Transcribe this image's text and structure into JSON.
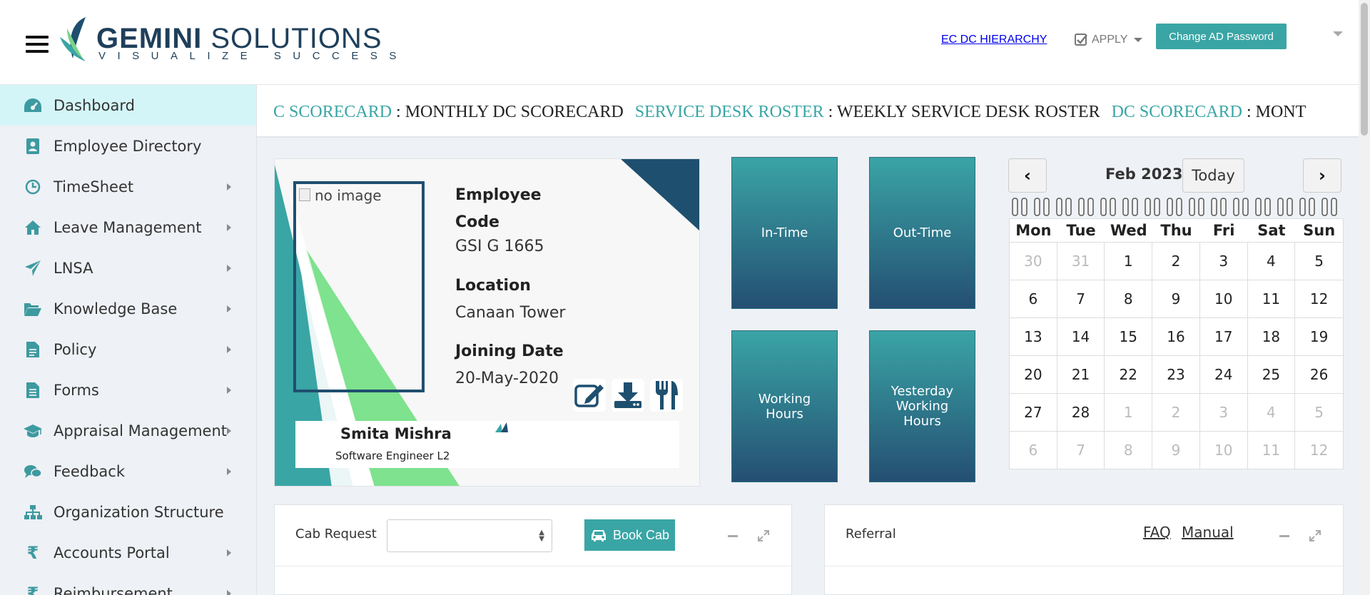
{
  "header": {
    "logo_name_bold": "GEMINI",
    "logo_name_rest": " SOLUTIONS",
    "logo_tagline": "VISUALIZE SUCCESS",
    "ec_dc_link": "EC DC HIERARCHY",
    "apply_label": "APPLY",
    "change_password_label": "Change AD Password"
  },
  "sidebar": {
    "items": [
      {
        "label": "Dashboard",
        "icon": "dashboard-icon",
        "submenu": false
      },
      {
        "label": "Employee Directory",
        "icon": "contact-book-icon",
        "submenu": false
      },
      {
        "label": "TimeSheet",
        "icon": "clock-icon",
        "submenu": true
      },
      {
        "label": "Leave Management",
        "icon": "home-icon",
        "submenu": true
      },
      {
        "label": "LNSA",
        "icon": "paper-plane-icon",
        "submenu": true
      },
      {
        "label": "Knowledge Base",
        "icon": "folder-open-icon",
        "submenu": true
      },
      {
        "label": "Policy",
        "icon": "document-icon",
        "submenu": true
      },
      {
        "label": "Forms",
        "icon": "form-document-icon",
        "submenu": true
      },
      {
        "label": "Appraisal Management",
        "icon": "graduation-cap-icon",
        "submenu": true
      },
      {
        "label": "Feedback",
        "icon": "chat-bubbles-icon",
        "submenu": true
      },
      {
        "label": "Organization Structure",
        "icon": "sitemap-icon",
        "submenu": false
      },
      {
        "label": "Accounts Portal",
        "icon": "rupee-icon",
        "submenu": true
      },
      {
        "label": "Reimbursement",
        "icon": "rupee-icon",
        "submenu": true
      }
    ]
  },
  "marquee": {
    "items": [
      {
        "key": "C SCORECARD",
        "value": " : MONTHLY DC SCORECARD"
      },
      {
        "key": "SERVICE DESK ROSTER",
        "value": " : WEEKLY SERVICE DESK ROSTER"
      },
      {
        "key": "DC SCORECARD",
        "value": " : MONT"
      }
    ]
  },
  "employee": {
    "photo_alt": "no image",
    "code_label": "Employee Code",
    "code_value": "GSI G 1665",
    "location_label": "Location",
    "location_value": "Canaan Tower",
    "joining_label": "Joining Date",
    "joining_value": "20-May-2020",
    "name": "Smita Mishra",
    "role": "Software Engineer L2"
  },
  "tiles": {
    "in_time": "In-Time",
    "out_time": "Out-Time",
    "working_hours": "Working Hours",
    "yesterday_working_hours": "Yesterday Working Hours"
  },
  "calendar": {
    "title": "Feb 2023",
    "today_label": "Today",
    "prev_label": "‹",
    "next_label": "›",
    "weekdays": [
      "Mon",
      "Tue",
      "Wed",
      "Thu",
      "Fri",
      "Sat",
      "Sun"
    ],
    "days": [
      {
        "d": "30",
        "muted": true
      },
      {
        "d": "31",
        "muted": true
      },
      {
        "d": "1"
      },
      {
        "d": "2"
      },
      {
        "d": "3"
      },
      {
        "d": "4"
      },
      {
        "d": "5"
      },
      {
        "d": "6"
      },
      {
        "d": "7"
      },
      {
        "d": "8"
      },
      {
        "d": "9"
      },
      {
        "d": "10"
      },
      {
        "d": "11"
      },
      {
        "d": "12"
      },
      {
        "d": "13"
      },
      {
        "d": "14"
      },
      {
        "d": "15"
      },
      {
        "d": "16"
      },
      {
        "d": "17"
      },
      {
        "d": "18"
      },
      {
        "d": "19"
      },
      {
        "d": "20"
      },
      {
        "d": "21"
      },
      {
        "d": "22"
      },
      {
        "d": "23"
      },
      {
        "d": "24"
      },
      {
        "d": "25"
      },
      {
        "d": "26"
      },
      {
        "d": "27"
      },
      {
        "d": "28"
      },
      {
        "d": "1",
        "muted": true
      },
      {
        "d": "2",
        "muted": true
      },
      {
        "d": "3",
        "muted": true
      },
      {
        "d": "4",
        "muted": true
      },
      {
        "d": "5",
        "muted": true
      },
      {
        "d": "6",
        "muted": true
      },
      {
        "d": "7",
        "muted": true
      },
      {
        "d": "8",
        "muted": true
      },
      {
        "d": "9",
        "muted": true
      },
      {
        "d": "10",
        "muted": true
      },
      {
        "d": "11",
        "muted": true
      },
      {
        "d": "12",
        "muted": true
      }
    ]
  },
  "cab": {
    "title": "Cab Request",
    "select_value": "",
    "book_label": "Book Cab"
  },
  "referral": {
    "title": "Referral",
    "faq_label": "FAQ",
    "manual_label": "Manual"
  },
  "colors": {
    "accent": "#3aa5a5",
    "navy": "#1f4f6f",
    "active_bg": "#d3f5f8"
  }
}
